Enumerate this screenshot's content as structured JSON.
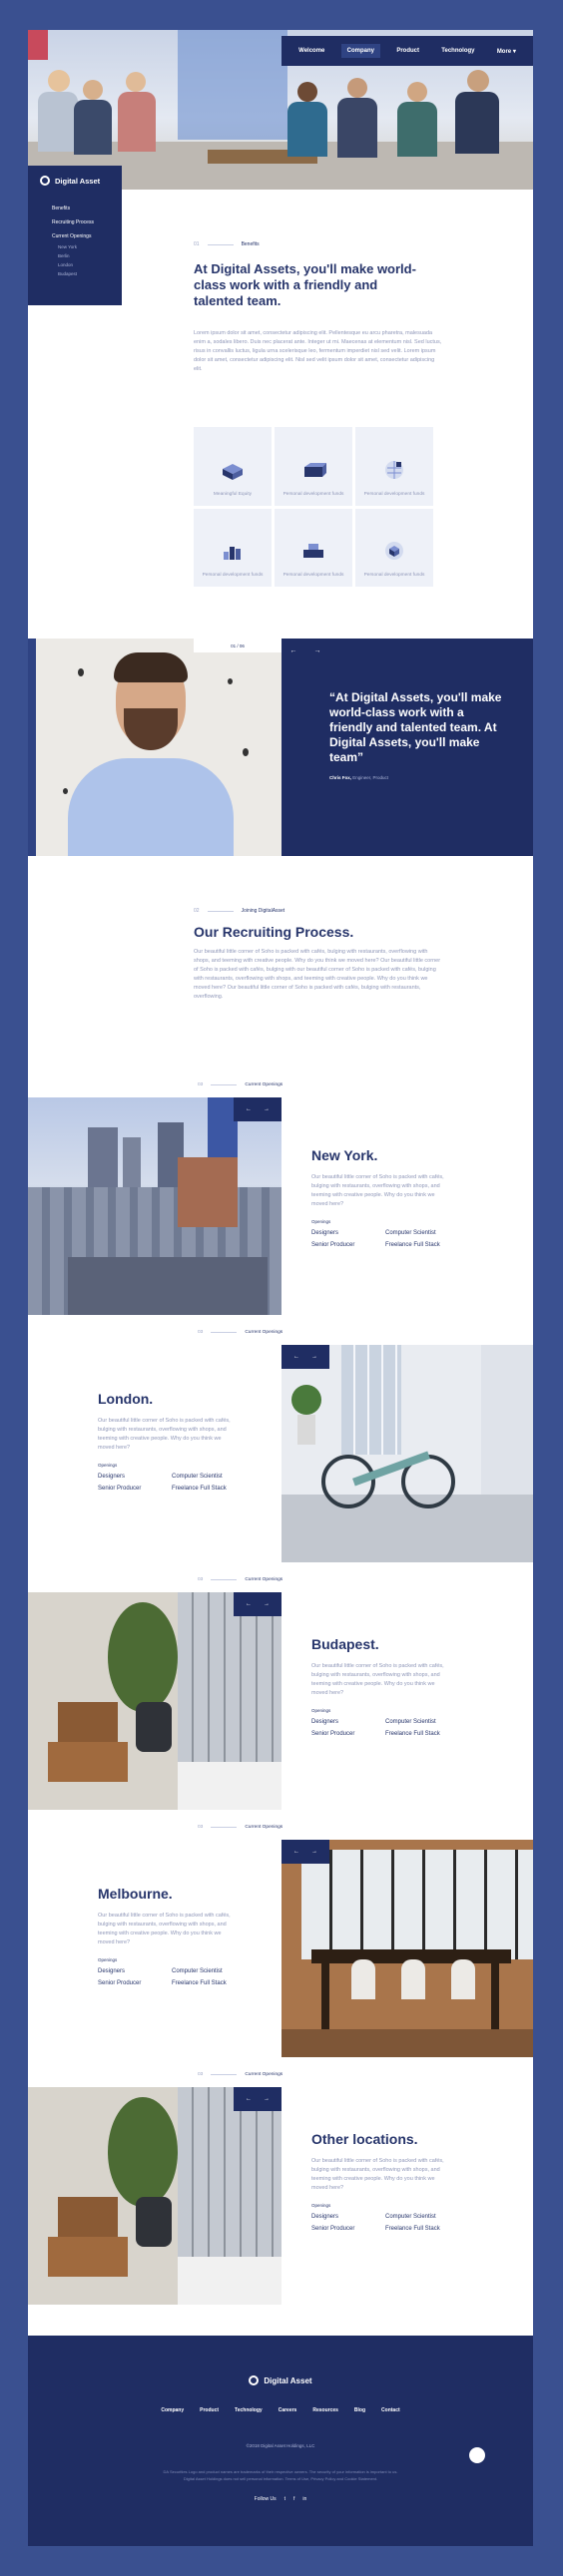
{
  "nav": {
    "items": [
      "Welcome",
      "Company",
      "Product",
      "Technology",
      "More"
    ],
    "active": 1
  },
  "sidebar": {
    "brand": "Digital Asset",
    "items": [
      "Benefits",
      "Recruiting Process",
      "Current Openings"
    ],
    "sub_items": [
      "New York",
      "Berlin",
      "London",
      "Budapest"
    ]
  },
  "intro": {
    "crumb_num": "01",
    "crumb_label": "Benefits",
    "title": "At Digital Assets, you'll make world-class work with a friendly and talented team.",
    "body": "Lorem ipsum dolor sit amet, consectetur adipiscing elit. Pellentesque eu arcu pharetra, malesuada enim a, sodales libero. Duis nec placerat ante. Integer ut mi. Maecenas at elementum nisl. Sed luctus, risus in convallis luctus, ligula urna scelerisque leo, fermentum imperdiet nisl sed velit. Lorem ipsum dolor sit amet, consectetur adipiscing elit. Nisl sed velit ipsum dolor sit amet, consectetur adipiscing elit."
  },
  "benefits": [
    {
      "label": "Meaningful Equity",
      "icon": "equity-icon"
    },
    {
      "label": "Personal development funds",
      "icon": "development-icon"
    },
    {
      "label": "Personal development funds",
      "icon": "globe-icon"
    },
    {
      "label": "Personal development funds",
      "icon": "chart-icon"
    },
    {
      "label": "Personal development funds",
      "icon": "blocks-icon"
    },
    {
      "label": "Personal development funds",
      "icon": "cube-icon"
    }
  ],
  "testimonial": {
    "pager": "01 / 06",
    "quote": "“At Digital Assets, you'll make world-class work with a friendly and talented team. At Digital Assets, you'll make team”",
    "author": "Chris Fox,",
    "role": "Engineer, Product"
  },
  "recruiting": {
    "crumb_num": "02",
    "crumb_label": "Joining DigitalAsset",
    "title": "Our Recruiting Process.",
    "body": "Our beautiful little corner of Soho is packed with cafés, bulging with restaurants, overflowing with shops, and teeming with creative people. Why do you think we moved here? Our beautiful little corner of Soho is packed with cafés, bulging with our beautiful corner of Soho is packed with cafés, bulging with restaurants, overflowing with shops, and teeming with creative people. Why do you think we moved here? Our beautiful little corner of Soho is packed with cafés, bulging with restaurants, overflowing."
  },
  "openings_label": "Current Openings",
  "openings_num": "03",
  "roles_label": "Openings",
  "city_desc": "Our beautiful little corner of Soho is packed with cafés, bulging with restaurants, overflowing with shops, and teeming with creative people. Why do you think we moved here?",
  "roles": [
    "Designers",
    "Computer Scientist",
    "Senior Producer",
    "Freelance Full Stack"
  ],
  "cities": [
    "New York.",
    "London.",
    "Budapest.",
    "Melbourne.",
    "Other locations."
  ],
  "footer": {
    "brand": "Digital Asset",
    "links": [
      "Company",
      "Product",
      "Technology",
      "Careers",
      "Resources",
      "Blog",
      "Contact"
    ],
    "copyright": "©2018 Digital Asset Holdings, LLC",
    "legal": "DA Securities Logo and product names are trademarks of their respective owners. The security of your information is important to us. Digital Asset Holdings does not sell personal information. Terms of Use, Privacy Policy and Cookie Statement.",
    "follow": "Follow Us"
  },
  "colors": {
    "navy": "#1f2d63",
    "frame": "#3a5090",
    "tile": "#eef1f8"
  }
}
